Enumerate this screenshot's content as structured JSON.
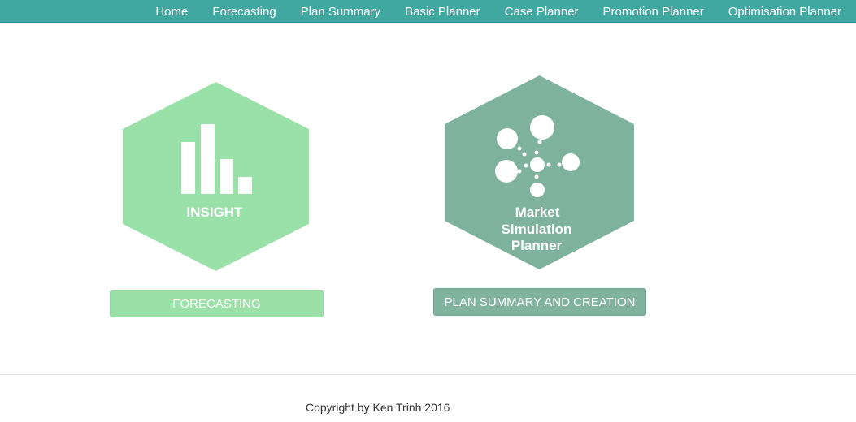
{
  "nav": {
    "items": [
      {
        "label": "Home"
      },
      {
        "label": "Forecasting"
      },
      {
        "label": "Plan Summary"
      },
      {
        "label": "Basic Planner"
      },
      {
        "label": "Case Planner"
      },
      {
        "label": "Promotion Planner"
      },
      {
        "label": "Optimisation Planner"
      }
    ]
  },
  "tiles": {
    "insight": {
      "label": "INSIGHT",
      "icon": "bar-chart-icon",
      "color": "#99e0a9"
    },
    "market": {
      "line1": "Market",
      "line2": "Simulation",
      "line3": "Planner",
      "icon": "network-bubbles-icon",
      "color": "#7fb29d"
    }
  },
  "buttons": {
    "forecasting": "FORECASTING",
    "plan": "PLAN SUMMARY AND CREATION"
  },
  "footer": {
    "copyright": "Copyright by Ken Trinh 2016"
  },
  "colors": {
    "navbar": "#41a8a1",
    "forecasting_button": "#9de0a7",
    "plan_button": "#7fb39e"
  }
}
